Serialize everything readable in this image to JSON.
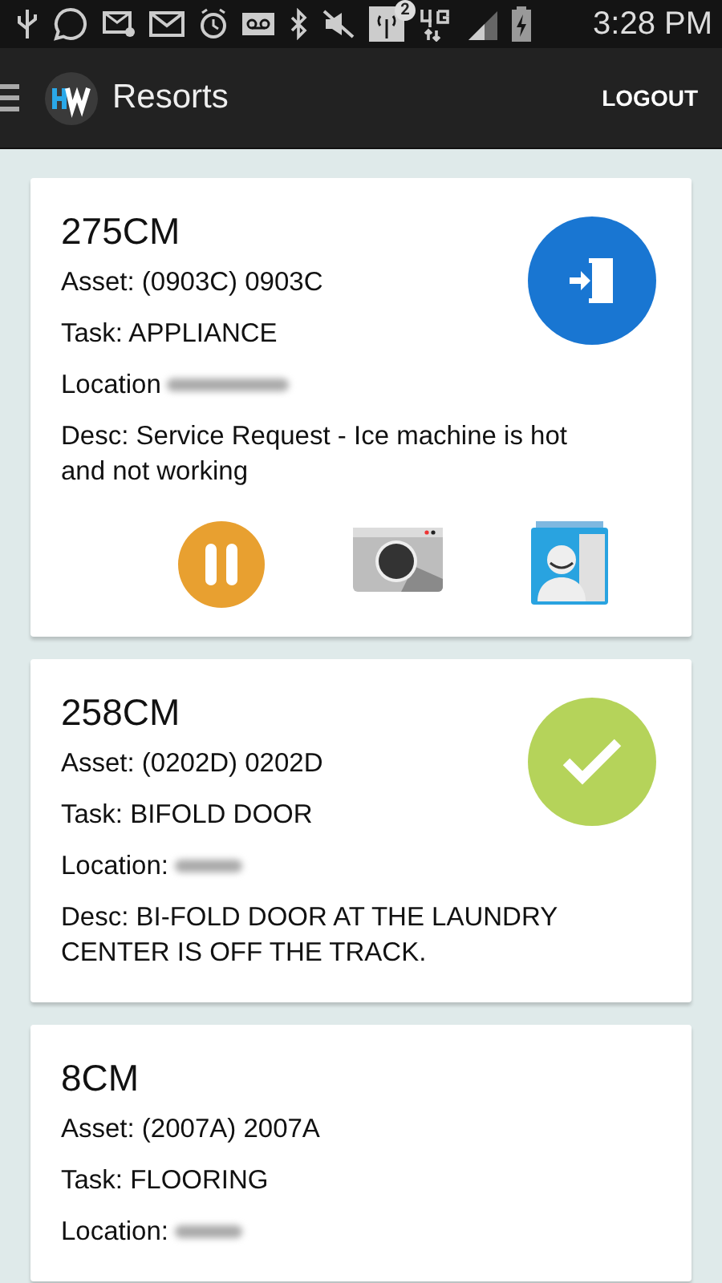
{
  "status_bar": {
    "notification_badge": "2",
    "time": "3:28 PM"
  },
  "app_bar": {
    "title": "Resorts",
    "action": "LOGOUT"
  },
  "work_orders": [
    {
      "number": "275CM",
      "asset": "Asset: (0903C) 0903C",
      "task": "Task: APPLIANCE",
      "location": "Location",
      "description": "Desc: Service Request - Ice machine is hot and not working",
      "status": {
        "kind": "checkin"
      },
      "actions": [
        {
          "kind": "pause"
        },
        {
          "kind": "camera"
        },
        {
          "kind": "contacts"
        }
      ]
    },
    {
      "number": "258CM",
      "asset": "Asset: (0202D) 0202D",
      "task": "Task: BIFOLD DOOR",
      "location": "Location:",
      "description": "Desc: BI-FOLD DOOR AT THE LAUNDRY CENTER IS OFF THE TRACK.",
      "status": {
        "kind": "done"
      }
    },
    {
      "number": "8CM",
      "asset": "Asset: (2007A) 2007A",
      "task": "Task: FLOORING",
      "location": "Location:"
    }
  ]
}
